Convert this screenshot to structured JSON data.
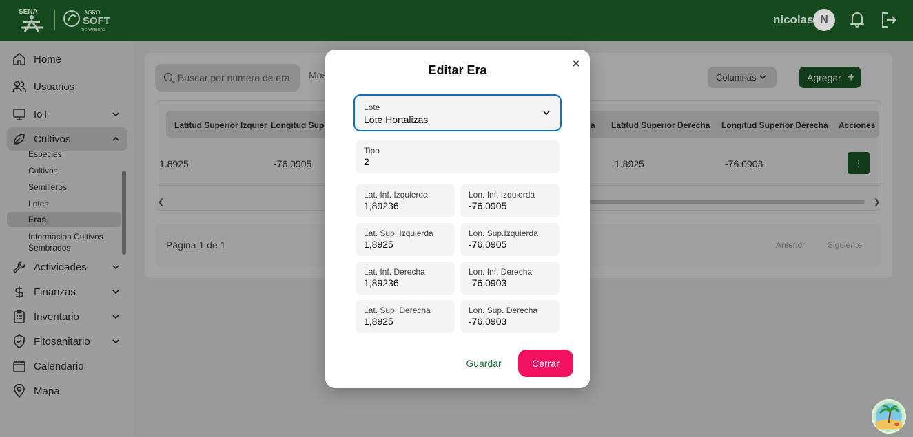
{
  "header": {
    "user_name": "nicolas",
    "avatar_initial": "N",
    "brand_logo_text": "SENA",
    "app_logo_text": "AGRO SOFT"
  },
  "sidebar": {
    "items": [
      {
        "label": "Home"
      },
      {
        "label": "Usuarios"
      },
      {
        "label": "IoT"
      },
      {
        "label": "Cultivos"
      },
      {
        "label": "Actividades"
      },
      {
        "label": "Finanzas"
      },
      {
        "label": "Inventario"
      },
      {
        "label": "Fitosanitario"
      },
      {
        "label": "Calendario"
      },
      {
        "label": "Mapa"
      }
    ],
    "cultivos_sub": [
      {
        "label": "Especies"
      },
      {
        "label": "Cultivos"
      },
      {
        "label": "Semilleros"
      },
      {
        "label": "Lotes"
      },
      {
        "label": "Eras"
      },
      {
        "label": "Informacion Cultivos Sembrados"
      }
    ]
  },
  "main": {
    "search_placeholder": "Buscar por numero de era",
    "mostrar_text": "Mos",
    "columns_button": "Columnas",
    "add_button": "Agregar",
    "table_headers": [
      "Latitud Superior Izquier",
      "Longitud Supe",
      "a",
      "Latitud Superior Derecha",
      "Longitud Superior Derecha",
      "Acciones"
    ],
    "row": {
      "lat_sup_izq": "1.8925",
      "lon_sup_izq": "-76.0905",
      "lat_sup_der": "1.8925",
      "lon_sup_der": "-76.0903"
    },
    "actions_icon": "⋮",
    "pagination_text": "Página 1 de 1",
    "prev_label": "Anterior",
    "next_label": "Siguiente"
  },
  "modal": {
    "title": "Editar Era",
    "lote": {
      "label": "Lote",
      "value": "Lote Hortalizas"
    },
    "tipo": {
      "label": "Tipo",
      "value": "2"
    },
    "fields": [
      {
        "label": "Lat. Inf. Izquierda",
        "value": "1,89236"
      },
      {
        "label": "Lon. Inf. Izquierda",
        "value": "-76,0905"
      },
      {
        "label": "Lat. Sup. Izquierda",
        "value": "1,8925"
      },
      {
        "label": "Lon. Sup.Izquierda",
        "value": "-76,0905"
      },
      {
        "label": "Lat. Inf. Derecha",
        "value": "1,89236"
      },
      {
        "label": "Lon. Inf. Derecha",
        "value": "-76,0903"
      },
      {
        "label": "Lat. Sup. Derecha",
        "value": "1,8925"
      },
      {
        "label": "Lon. Sup. Derecha",
        "value": "-76,0903"
      }
    ],
    "save_label": "Guardar",
    "close_label": "Cerrar"
  },
  "colors": {
    "header_green": "#154a1f",
    "primary_green": "#123b19",
    "select_focus": "#0a6fd3",
    "danger": "#f31260"
  }
}
